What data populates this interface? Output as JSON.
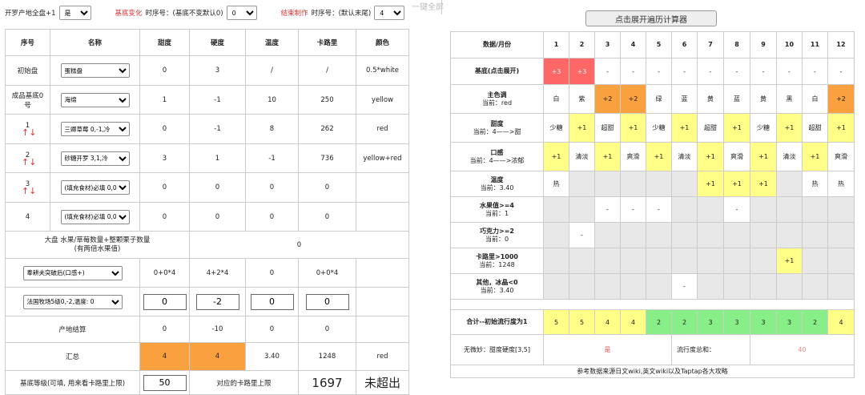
{
  "top": {
    "full_label": "开罗产地全盘+1",
    "full_value": "是",
    "base_change_red": "基底变化",
    "base_change_label": "时序号：(基底不变默认0)",
    "base_change_value": "0",
    "end_red": "结束制作",
    "end_label": "时序号：(默认末尾)",
    "end_value": "4",
    "fullscreen": "一键全屏"
  },
  "left": {
    "headers": [
      "序号",
      "名称",
      "甜度",
      "硬度",
      "温度",
      "卡路里",
      "颜色"
    ],
    "rows": [
      {
        "idx": "初始盘",
        "name": "蛋糕盘",
        "sweet": "0",
        "hard": "3",
        "temp": "/",
        "cal": "/",
        "color": "0.5*white"
      },
      {
        "idx": "成品基底0号",
        "name": "海绵",
        "sweet": "1",
        "hard": "-1",
        "temp": "10",
        "cal": "250",
        "color": "yellow"
      },
      {
        "idx": "1",
        "name": "三卿草莓  0,-1,冷",
        "sweet": "0",
        "hard": "-1",
        "temp": "8",
        "cal": "262",
        "color": "red"
      },
      {
        "idx": "2",
        "name": "砂糖开罗  3,1,冷",
        "sweet": "3",
        "hard": "1",
        "temp": "-1",
        "cal": "736",
        "color": "yellow+red"
      },
      {
        "idx": "3",
        "name": "(填充食材)必填  0,0",
        "sweet": "0",
        "hard": "0",
        "temp": "0",
        "cal": "0",
        "color": ""
      },
      {
        "idx": "4",
        "name": "(填充食材)必填  0,0",
        "sweet": "0",
        "hard": "0",
        "temp": "0",
        "cal": "0",
        "color": ""
      }
    ],
    "arrow_glyph": "↑↓",
    "big_plate_label": "大盘 水果/草莓数量+整颗栗子数量\n(有两倍水果值)",
    "big_plate_value": "0",
    "extra1": {
      "select": "奉耕夫突破后(口感+)",
      "sweet": "0+0*4",
      "hard": "4+2*4",
      "temp": "0",
      "cal": "0+0*4"
    },
    "extra2": {
      "select": "法国牧场5级0,-2,温度: 0",
      "sweet": "0",
      "hard": "-2",
      "temp": "0",
      "cal": "0"
    },
    "place": {
      "label": "产地结算",
      "sweet": "0",
      "hard": "-10",
      "temp": "0",
      "cal": "0"
    },
    "total": {
      "label": "汇总",
      "sweet": "4",
      "hard": "4",
      "temp": "3.40",
      "cal": "1248",
      "color": "red"
    },
    "level": {
      "label": "基底等级(可填, 用来看卡路里上限)",
      "value": "50",
      "limit_label": "对应的卡路里上限",
      "limit": "1697",
      "status": "未超出"
    }
  },
  "right": {
    "button": "点击展开遍历计算器",
    "header_label": "数据/月份",
    "months": [
      "1",
      "2",
      "3",
      "4",
      "5",
      "6",
      "7",
      "8",
      "9",
      "10",
      "11",
      "12"
    ],
    "rows": [
      {
        "label": "基底(点击展开)",
        "current": "",
        "cells": [
          [
            "+3",
            "red"
          ],
          [
            "+3",
            "red"
          ],
          [
            "-",
            ""
          ],
          [
            "-",
            ""
          ],
          [
            "-",
            ""
          ],
          [
            "-",
            ""
          ],
          [
            "-",
            ""
          ],
          [
            "-",
            ""
          ],
          [
            "-",
            ""
          ],
          [
            "-",
            ""
          ],
          [
            "-",
            ""
          ],
          [
            "-",
            ""
          ]
        ]
      },
      {
        "label": "主色调",
        "current": "当前：red",
        "cells": [
          [
            "白",
            ""
          ],
          [
            "紫",
            ""
          ],
          [
            "+2",
            "or"
          ],
          [
            "+2",
            "or"
          ],
          [
            "绿",
            ""
          ],
          [
            "蓝",
            ""
          ],
          [
            "黄",
            ""
          ],
          [
            "蓝",
            ""
          ],
          [
            "黄",
            ""
          ],
          [
            "黑",
            ""
          ],
          [
            "白",
            ""
          ],
          [
            "+2",
            "or"
          ]
        ]
      },
      {
        "label": "甜度",
        "current": "当前：4——>甜",
        "cells": [
          [
            "少糖",
            ""
          ],
          [
            "+1",
            "ye"
          ],
          [
            "超甜",
            ""
          ],
          [
            "+1",
            "ye"
          ],
          [
            "少糖",
            ""
          ],
          [
            "+1",
            "ye"
          ],
          [
            "超甜",
            ""
          ],
          [
            "+1",
            "ye"
          ],
          [
            "少糖",
            ""
          ],
          [
            "+1",
            "ye"
          ],
          [
            "超甜",
            ""
          ],
          [
            "+1",
            "ye"
          ]
        ]
      },
      {
        "label": "口感",
        "current": "当前：4——>浓郁",
        "cells": [
          [
            "+1",
            "ye"
          ],
          [
            "清淡",
            ""
          ],
          [
            "+1",
            "ye"
          ],
          [
            "爽滑",
            ""
          ],
          [
            "+1",
            "ye"
          ],
          [
            "清淡",
            ""
          ],
          [
            "+1",
            "ye"
          ],
          [
            "爽滑",
            ""
          ],
          [
            "+1",
            "ye"
          ],
          [
            "清淡",
            ""
          ],
          [
            "+1",
            "ye"
          ],
          [
            "爽滑",
            ""
          ]
        ]
      },
      {
        "label": "温度",
        "current": "当前：3.40",
        "cells": [
          [
            "热",
            ""
          ],
          [
            "",
            "grey"
          ],
          [
            "",
            "grey"
          ],
          [
            "",
            "grey"
          ],
          [
            "",
            "grey"
          ],
          [
            "",
            "grey"
          ],
          [
            "+1",
            "ye"
          ],
          [
            "+1",
            "ye"
          ],
          [
            "+1",
            "ye"
          ],
          [
            "",
            "grey"
          ],
          [
            "热",
            ""
          ],
          [
            "热",
            ""
          ]
        ]
      },
      {
        "label": "水果值>=4",
        "current": "当前：1",
        "cells": [
          [
            "",
            "grey"
          ],
          [
            "",
            "grey"
          ],
          [
            "-",
            ""
          ],
          [
            "-",
            ""
          ],
          [
            "-",
            ""
          ],
          [
            "",
            "grey"
          ],
          [
            "",
            "grey"
          ],
          [
            "-",
            ""
          ],
          [
            "",
            "grey"
          ],
          [
            "",
            "grey"
          ],
          [
            "",
            "grey"
          ],
          [
            "",
            "grey"
          ]
        ]
      },
      {
        "label": "巧克力>=2",
        "current": "当前：0",
        "cells": [
          [
            "",
            "grey"
          ],
          [
            "-",
            ""
          ],
          [
            "",
            "grey"
          ],
          [
            "",
            "grey"
          ],
          [
            "",
            "grey"
          ],
          [
            "",
            "grey"
          ],
          [
            "",
            "grey"
          ],
          [
            "",
            "grey"
          ],
          [
            "",
            "grey"
          ],
          [
            "",
            "grey"
          ],
          [
            "",
            "grey"
          ],
          [
            "",
            "grey"
          ]
        ]
      },
      {
        "label": "卡路里>1000",
        "current": "当前：1248",
        "cells": [
          [
            "",
            "grey"
          ],
          [
            "",
            "grey"
          ],
          [
            "",
            "grey"
          ],
          [
            "",
            "grey"
          ],
          [
            "",
            "grey"
          ],
          [
            "",
            "grey"
          ],
          [
            "",
            "grey"
          ],
          [
            "",
            "grey"
          ],
          [
            "",
            "grey"
          ],
          [
            "+1",
            "ye"
          ],
          [
            "",
            "grey"
          ],
          [
            "",
            "grey"
          ]
        ]
      },
      {
        "label": "其他，冰晶<0",
        "current": "当前：3.40",
        "cells": [
          [
            "",
            "grey"
          ],
          [
            "",
            "grey"
          ],
          [
            "",
            "grey"
          ],
          [
            "",
            "grey"
          ],
          [
            "",
            "grey"
          ],
          [
            "-",
            ""
          ],
          [
            "",
            "grey"
          ],
          [
            "",
            "grey"
          ],
          [
            "",
            "grey"
          ],
          [
            "",
            "grey"
          ],
          [
            "",
            "grey"
          ],
          [
            "",
            "grey"
          ]
        ]
      }
    ],
    "total_label": "合计--初始流行度为1",
    "totals": [
      [
        "5",
        "ye"
      ],
      [
        "5",
        "ye"
      ],
      [
        "4",
        "ye"
      ],
      [
        "4",
        "ye"
      ],
      [
        "2",
        "gr"
      ],
      [
        "2",
        "gr"
      ],
      [
        "3",
        "gr"
      ],
      [
        "3",
        "gr"
      ],
      [
        "3",
        "gr"
      ],
      [
        "3",
        "gr"
      ],
      [
        "2",
        "gr"
      ],
      [
        "4",
        "ye"
      ]
    ],
    "nowei_label": "无微妙：甜度硬度[3,5]",
    "nowei_value": "是",
    "pop_label": "流行度总和：",
    "pop_value": "40",
    "footer": "参考数据来源日文wiki,英文wiki以及Taptap各大攻略"
  }
}
